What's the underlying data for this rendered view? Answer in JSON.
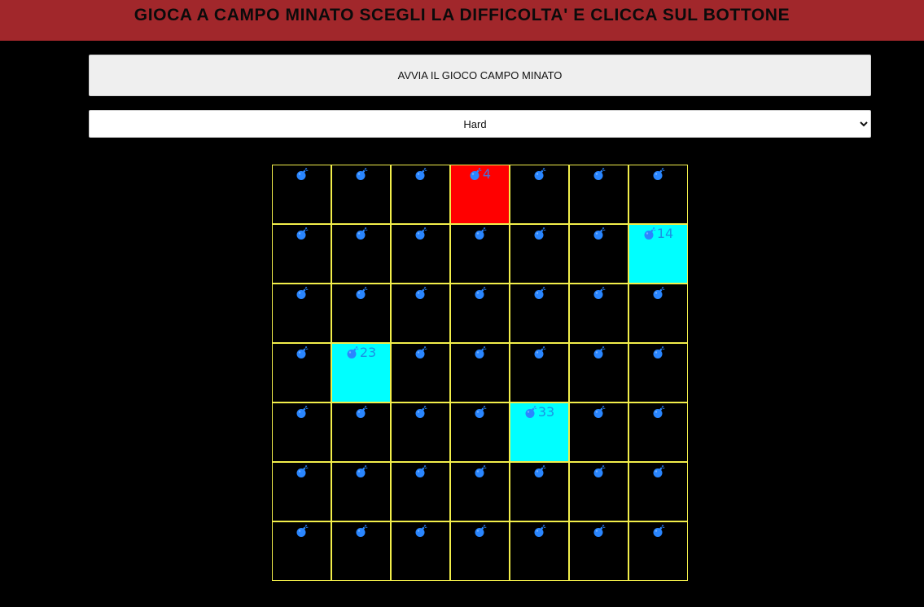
{
  "header": {
    "title": "GIOCA A CAMPO MINATO SCEGLI LA DIFFICOLTA' E CLICCA SUL BOTTONE"
  },
  "controls": {
    "start_label": "AVVIA IL GIOCO CAMPO MINATO",
    "difficulty_selected": "Hard"
  },
  "colors": {
    "header_bg": "#a1272b",
    "cell_border": "#f2ee4a",
    "bomb_hit": "#ff0000",
    "revealed_safe": "#00ffff",
    "bomb_icon": "#2a86ff"
  },
  "board": {
    "columns": 7,
    "rows": 7,
    "cell_icon": "bomb-icon",
    "cells": [
      {
        "state": "hidden",
        "label": ""
      },
      {
        "state": "hidden",
        "label": ""
      },
      {
        "state": "hidden",
        "label": ""
      },
      {
        "state": "bomb-hit",
        "label": "4"
      },
      {
        "state": "hidden",
        "label": ""
      },
      {
        "state": "hidden",
        "label": ""
      },
      {
        "state": "hidden",
        "label": ""
      },
      {
        "state": "hidden",
        "label": ""
      },
      {
        "state": "hidden",
        "label": ""
      },
      {
        "state": "hidden",
        "label": ""
      },
      {
        "state": "hidden",
        "label": ""
      },
      {
        "state": "hidden",
        "label": ""
      },
      {
        "state": "hidden",
        "label": ""
      },
      {
        "state": "safe",
        "label": "14"
      },
      {
        "state": "hidden",
        "label": ""
      },
      {
        "state": "hidden",
        "label": ""
      },
      {
        "state": "hidden",
        "label": ""
      },
      {
        "state": "hidden",
        "label": ""
      },
      {
        "state": "hidden",
        "label": ""
      },
      {
        "state": "hidden",
        "label": ""
      },
      {
        "state": "hidden",
        "label": ""
      },
      {
        "state": "hidden",
        "label": ""
      },
      {
        "state": "safe",
        "label": "23"
      },
      {
        "state": "hidden",
        "label": ""
      },
      {
        "state": "hidden",
        "label": ""
      },
      {
        "state": "hidden",
        "label": ""
      },
      {
        "state": "hidden",
        "label": ""
      },
      {
        "state": "hidden",
        "label": ""
      },
      {
        "state": "hidden",
        "label": ""
      },
      {
        "state": "hidden",
        "label": ""
      },
      {
        "state": "hidden",
        "label": ""
      },
      {
        "state": "hidden",
        "label": ""
      },
      {
        "state": "safe",
        "label": "33"
      },
      {
        "state": "hidden",
        "label": ""
      },
      {
        "state": "hidden",
        "label": ""
      },
      {
        "state": "hidden",
        "label": ""
      },
      {
        "state": "hidden",
        "label": ""
      },
      {
        "state": "hidden",
        "label": ""
      },
      {
        "state": "hidden",
        "label": ""
      },
      {
        "state": "hidden",
        "label": ""
      },
      {
        "state": "hidden",
        "label": ""
      },
      {
        "state": "hidden",
        "label": ""
      },
      {
        "state": "hidden",
        "label": ""
      },
      {
        "state": "hidden",
        "label": ""
      },
      {
        "state": "hidden",
        "label": ""
      },
      {
        "state": "hidden",
        "label": ""
      },
      {
        "state": "hidden",
        "label": ""
      },
      {
        "state": "hidden",
        "label": ""
      },
      {
        "state": "hidden",
        "label": ""
      }
    ]
  }
}
